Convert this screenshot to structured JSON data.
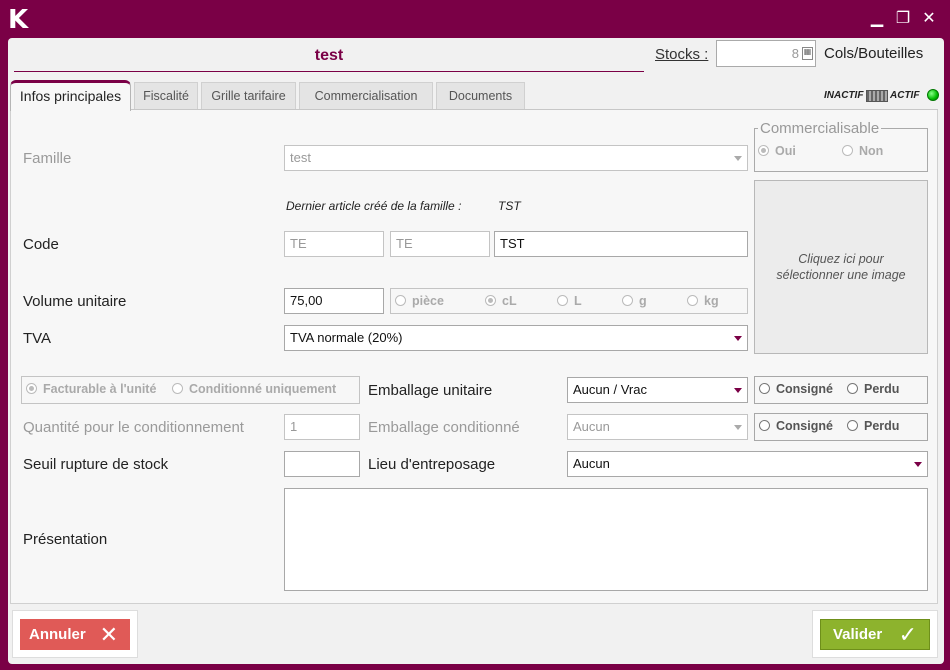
{
  "window": {
    "logo": "K",
    "minimize": "▁",
    "maximize": "❐",
    "close": "✕"
  },
  "header": {
    "record_name": "test",
    "stocks_label": "Stocks :",
    "stocks_value": "8",
    "stocks_unit": "Cols/Bouteilles"
  },
  "tabs": [
    {
      "label": "Infos principales",
      "active": true
    },
    {
      "label": "Fiscalité",
      "active": false
    },
    {
      "label": "Grille tarifaire",
      "active": false
    },
    {
      "label": "Commercialisation",
      "active": false
    },
    {
      "label": "Documents",
      "active": false
    }
  ],
  "status": {
    "inactive_label": "INACTIF",
    "active_label": "ACTIF",
    "led_color": "#00bb00"
  },
  "form": {
    "famille_label": "Famille",
    "famille_value": "test",
    "commercialisable_legend": "Commercialisable",
    "commercialisable_yes": "Oui",
    "commercialisable_no": "Non",
    "last_article_label": "Dernier article créé de la famille :",
    "last_article_value": "TST",
    "image_hint_line1": "Cliquez ici pour",
    "image_hint_line2": "sélectionner une image",
    "code_label": "Code",
    "code_part1": "TE",
    "code_part2": "TE",
    "code_part3": "TST",
    "volume_label": "Volume unitaire",
    "volume_value": "75,00",
    "units": [
      "pièce",
      "cL",
      "L",
      "g",
      "kg"
    ],
    "tva_label": "TVA",
    "tva_value": "TVA normale (20%)",
    "billing_unit": "Facturable à l'unité",
    "billing_pack": "Conditionné uniquement",
    "emb_unit_label": "Emballage unitaire",
    "emb_unit_value": "Aucun / Vrac",
    "consigne": "Consigné",
    "perdu": "Perdu",
    "qty_pack_label": "Quantité pour le conditionnement",
    "qty_pack_value": "1",
    "emb_pack_label": "Emballage conditionné",
    "emb_pack_value": "Aucun",
    "seuil_label": "Seuil rupture de stock",
    "seuil_value": "",
    "lieu_label": "Lieu d'entreposage",
    "lieu_value": "Aucun",
    "presentation_label": "Présentation"
  },
  "footer": {
    "cancel_label": "Annuler",
    "cancel_icon": "✕",
    "ok_label": "Valider",
    "ok_icon": "✓"
  },
  "colors": {
    "brand": "#7a0046",
    "cancel": "#e05a57",
    "ok": "#8db32d"
  }
}
